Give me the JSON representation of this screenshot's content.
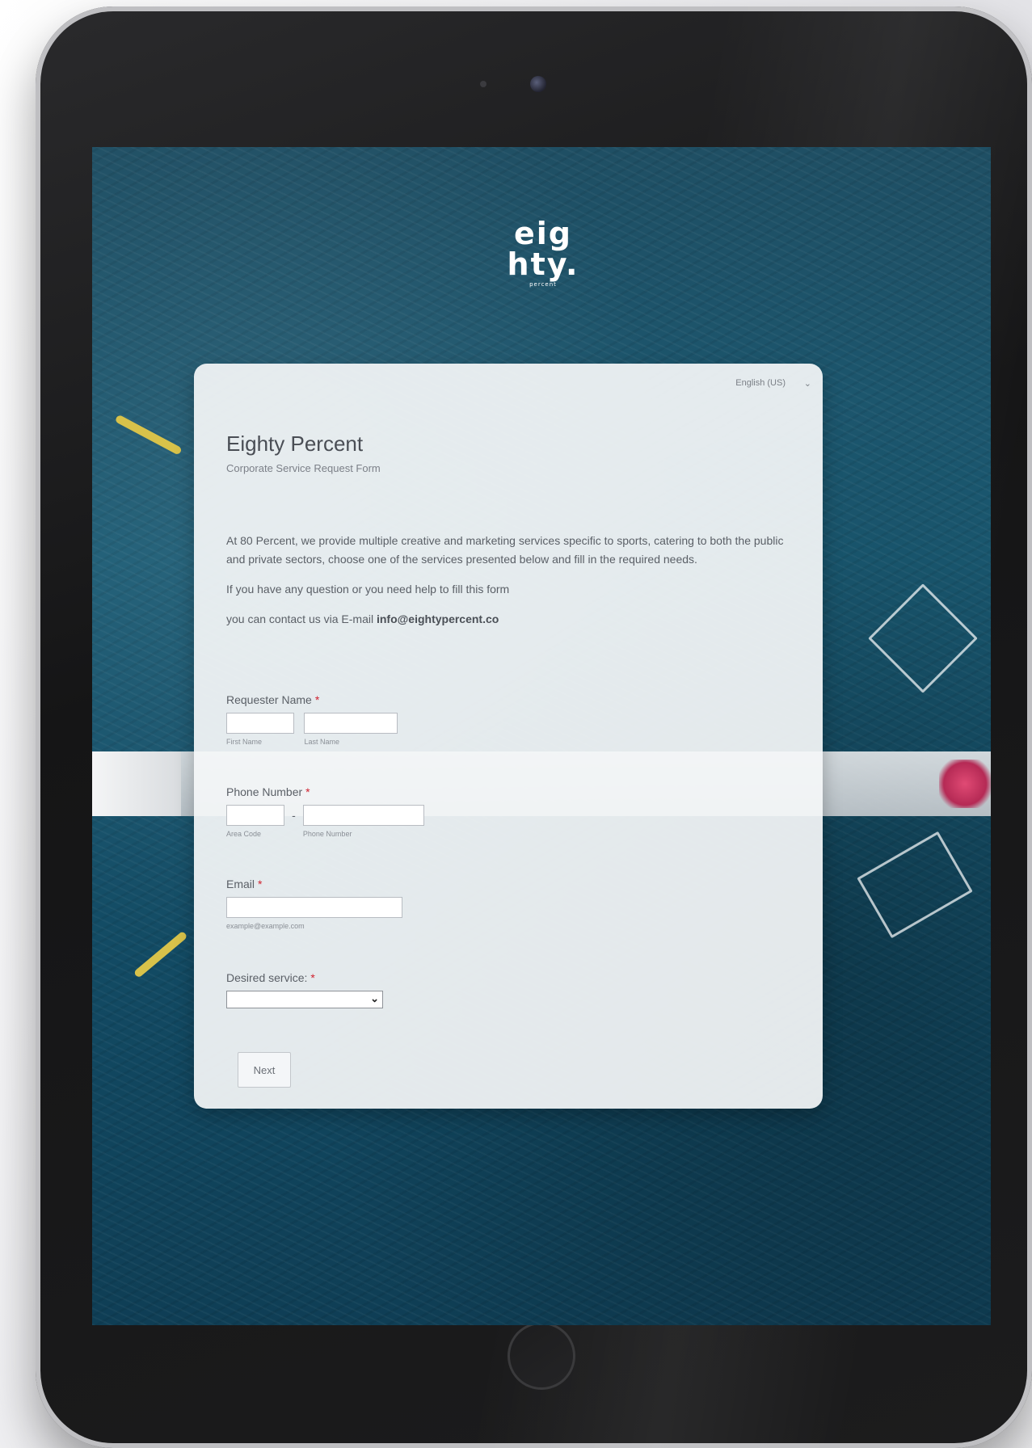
{
  "logo": {
    "line1": "eig",
    "line2": "hty.",
    "sub": "percent"
  },
  "language_selector": {
    "value": "English (US)",
    "caret": "⌄"
  },
  "form": {
    "title": "Eighty Percent",
    "subtitle": "Corporate Service Request Form",
    "intro": [
      "At 80 Percent, we provide multiple creative and marketing services specific to sports, catering to both the public and private sectors, choose one of the services presented below and fill in the required needs.",
      "If you have any question or you need help to fill this form",
      "you can contact us via E-mail"
    ],
    "contact_email": "info@eightypercent.co",
    "fields": {
      "name": {
        "label": "Requester Name",
        "first_sub": "First Name",
        "last_sub": "Last Name"
      },
      "phone": {
        "label": "Phone Number",
        "area_sub": "Area Code",
        "number_sub": "Phone Number",
        "separator": "-"
      },
      "email": {
        "label": "Email",
        "example": "example@example.com"
      },
      "service": {
        "label": "Desired service:",
        "selected": ""
      }
    },
    "required_marker": "*",
    "next_label": "Next"
  }
}
